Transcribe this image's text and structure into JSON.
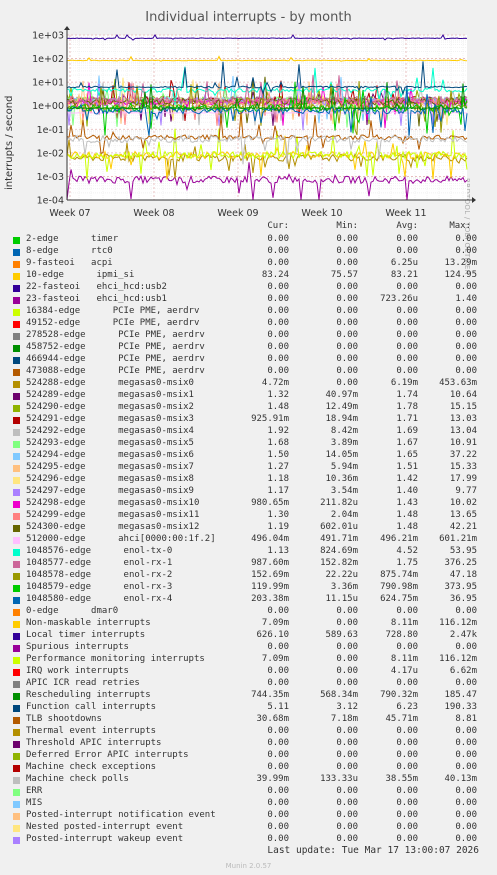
{
  "title": "Individual interrupts - by month",
  "side_label": "RRDTOOL / TOBI OETIKER",
  "footer": {
    "last_update": "Last update: Tue Mar 17 13:00:07 2026",
    "munin": "Munin 2.0.57"
  },
  "legend_headers": {
    "cur": "Cur:",
    "min": "Min:",
    "avg": "Avg:",
    "max": "Max:"
  },
  "chart_data": {
    "type": "line",
    "title": "Individual interrupts - by month",
    "ylabel": "interrupts / second",
    "xlabel": "",
    "y_scale": "log",
    "ylim": [
      0.0001,
      1000
    ],
    "y_ticks": [
      "1e-04",
      "1e-03",
      "1e-02",
      "1e-01",
      "1e+00",
      "1e+01",
      "1e+02",
      "1e+03"
    ],
    "x_ticks": [
      "Week 07",
      "Week 08",
      "Week 09",
      "Week 10",
      "Week 11"
    ],
    "grid": true,
    "series": [
      {
        "name": "2-edge      timer",
        "color": "#00cc00",
        "cur": "0.00",
        "min": "0.00",
        "avg": "0.00",
        "max": "0.00"
      },
      {
        "name": "8-edge      rtc0",
        "color": "#0066b3",
        "cur": "0.00",
        "min": "0.00",
        "avg": "0.00",
        "max": "0.00"
      },
      {
        "name": "9-fasteoi   acpi",
        "color": "#ff8000",
        "cur": "0.00",
        "min": "0.00",
        "avg": "6.25u",
        "max": "13.29m"
      },
      {
        "name": "10-edge      ipmi_si",
        "color": "#ffcc00",
        "cur": "83.24",
        "min": "75.57",
        "avg": "83.21",
        "max": "124.95"
      },
      {
        "name": "22-fasteoi   ehci_hcd:usb2",
        "color": "#330099",
        "cur": "0.00",
        "min": "0.00",
        "avg": "0.00",
        "max": "0.00"
      },
      {
        "name": "23-fasteoi   ehci_hcd:usb1",
        "color": "#990099",
        "cur": "0.00",
        "min": "0.00",
        "avg": "723.26u",
        "max": "1.40"
      },
      {
        "name": "16384-edge      PCIe PME, aerdrv",
        "color": "#ccff00",
        "cur": "0.00",
        "min": "0.00",
        "avg": "0.00",
        "max": "0.00"
      },
      {
        "name": "49152-edge      PCIe PME, aerdrv",
        "color": "#ff0000",
        "cur": "0.00",
        "min": "0.00",
        "avg": "0.00",
        "max": "0.00"
      },
      {
        "name": "278528-edge      PCIe PME, aerdrv",
        "color": "#808080",
        "cur": "0.00",
        "min": "0.00",
        "avg": "0.00",
        "max": "0.00"
      },
      {
        "name": "458752-edge      PCIe PME, aerdrv",
        "color": "#008f00",
        "cur": "0.00",
        "min": "0.00",
        "avg": "0.00",
        "max": "0.00"
      },
      {
        "name": "466944-edge      PCIe PME, aerdrv",
        "color": "#00487d",
        "cur": "0.00",
        "min": "0.00",
        "avg": "0.00",
        "max": "0.00"
      },
      {
        "name": "473088-edge      PCIe PME, aerdrv",
        "color": "#b35a00",
        "cur": "0.00",
        "min": "0.00",
        "avg": "0.00",
        "max": "0.00"
      },
      {
        "name": "524288-edge      megasas0-msix0",
        "color": "#b38f00",
        "cur": "4.72m",
        "min": "0.00",
        "avg": "6.19m",
        "max": "453.63m"
      },
      {
        "name": "524289-edge      megasas0-msix1",
        "color": "#6b006b",
        "cur": "1.32",
        "min": "40.97m",
        "avg": "1.74",
        "max": "10.64"
      },
      {
        "name": "524290-edge      megasas0-msix2",
        "color": "#8fb300",
        "cur": "1.48",
        "min": "12.49m",
        "avg": "1.78",
        "max": "15.15"
      },
      {
        "name": "524291-edge      megasas0-msix3",
        "color": "#b30000",
        "cur": "925.91m",
        "min": "18.94m",
        "avg": "1.71",
        "max": "13.03"
      },
      {
        "name": "524292-edge      megasas0-msix4",
        "color": "#bebebe",
        "cur": "1.92",
        "min": "8.42m",
        "avg": "1.69",
        "max": "13.04"
      },
      {
        "name": "524293-edge      megasas0-msix5",
        "color": "#80ff80",
        "cur": "1.68",
        "min": "3.89m",
        "avg": "1.67",
        "max": "10.91"
      },
      {
        "name": "524294-edge      megasas0-msix6",
        "color": "#80c9ff",
        "cur": "1.50",
        "min": "14.05m",
        "avg": "1.65",
        "max": "37.22"
      },
      {
        "name": "524295-edge      megasas0-msix7",
        "color": "#ffc080",
        "cur": "1.27",
        "min": "5.94m",
        "avg": "1.51",
        "max": "15.33"
      },
      {
        "name": "524296-edge      megasas0-msix8",
        "color": "#ffe680",
        "cur": "1.18",
        "min": "10.36m",
        "avg": "1.42",
        "max": "17.99"
      },
      {
        "name": "524297-edge      megasas0-msix9",
        "color": "#aa80ff",
        "cur": "1.17",
        "min": "3.54m",
        "avg": "1.40",
        "max": "9.77"
      },
      {
        "name": "524298-edge      megasas0-msix10",
        "color": "#ee00cc",
        "cur": "980.65m",
        "min": "211.82u",
        "avg": "1.43",
        "max": "10.02"
      },
      {
        "name": "524299-edge      megasas0-msix11",
        "color": "#ff8080",
        "cur": "1.30",
        "min": "2.04m",
        "avg": "1.48",
        "max": "13.65"
      },
      {
        "name": "524300-edge      megasas0-msix12",
        "color": "#666600",
        "cur": "1.19",
        "min": "602.01u",
        "avg": "1.48",
        "max": "42.21"
      },
      {
        "name": "512000-edge      ahci[0000:00:1f.2]",
        "color": "#ffbfff",
        "cur": "496.04m",
        "min": "491.71m",
        "avg": "496.21m",
        "max": "601.21m"
      },
      {
        "name": "1048576-edge      enol-tx-0",
        "color": "#00ffcc",
        "cur": "1.13",
        "min": "824.69m",
        "avg": "4.52",
        "max": "53.95"
      },
      {
        "name": "1048577-edge      enol-rx-1",
        "color": "#cc6699",
        "cur": "987.60m",
        "min": "152.82m",
        "avg": "1.75",
        "max": "376.25"
      },
      {
        "name": "1048578-edge      enol-rx-2",
        "color": "#999900",
        "cur": "152.69m",
        "min": "22.22u",
        "avg": "875.74m",
        "max": "47.18"
      },
      {
        "name": "1048579-edge      enol-rx-3",
        "color": "#00cc00",
        "cur": "119.99m",
        "min": "3.36m",
        "avg": "790.98m",
        "max": "373.95"
      },
      {
        "name": "1048580-edge      enol-rx-4",
        "color": "#0066b3",
        "cur": "203.38m",
        "min": "11.15u",
        "avg": "624.75m",
        "max": "36.95"
      },
      {
        "name": "0-edge      dmar0",
        "color": "#ff8000",
        "cur": "0.00",
        "min": "0.00",
        "avg": "0.00",
        "max": "0.00"
      },
      {
        "name": "Non-maskable interrupts",
        "color": "#ffcc00",
        "cur": "7.09m",
        "min": "0.00",
        "avg": "8.11m",
        "max": "116.12m"
      },
      {
        "name": "Local timer interrupts",
        "color": "#330099",
        "cur": "626.10",
        "min": "589.63",
        "avg": "728.80",
        "max": "2.47k"
      },
      {
        "name": "Spurious interrupts",
        "color": "#990099",
        "cur": "0.00",
        "min": "0.00",
        "avg": "0.00",
        "max": "0.00"
      },
      {
        "name": "Performance monitoring interrupts",
        "color": "#ccff00",
        "cur": "7.09m",
        "min": "0.00",
        "avg": "8.11m",
        "max": "116.12m"
      },
      {
        "name": "IRQ work interrupts",
        "color": "#ff0000",
        "cur": "0.00",
        "min": "0.00",
        "avg": "4.17u",
        "max": "6.62m"
      },
      {
        "name": "APIC ICR read retries",
        "color": "#808080",
        "cur": "0.00",
        "min": "0.00",
        "avg": "0.00",
        "max": "0.00"
      },
      {
        "name": "Rescheduling interrupts",
        "color": "#008f00",
        "cur": "744.35m",
        "min": "568.34m",
        "avg": "790.32m",
        "max": "185.47"
      },
      {
        "name": "Function call interrupts",
        "color": "#00487d",
        "cur": "5.11",
        "min": "3.12",
        "avg": "6.23",
        "max": "190.33"
      },
      {
        "name": "TLB shootdowns",
        "color": "#b35a00",
        "cur": "30.68m",
        "min": "7.18m",
        "avg": "45.71m",
        "max": "8.81"
      },
      {
        "name": "Thermal event interrupts",
        "color": "#b38f00",
        "cur": "0.00",
        "min": "0.00",
        "avg": "0.00",
        "max": "0.00"
      },
      {
        "name": "Threshold APIC interrupts",
        "color": "#6b006b",
        "cur": "0.00",
        "min": "0.00",
        "avg": "0.00",
        "max": "0.00"
      },
      {
        "name": "Deferred Error APIC interrupts",
        "color": "#8fb300",
        "cur": "0.00",
        "min": "0.00",
        "avg": "0.00",
        "max": "0.00"
      },
      {
        "name": "Machine check exceptions",
        "color": "#b30000",
        "cur": "0.00",
        "min": "0.00",
        "avg": "0.00",
        "max": "0.00"
      },
      {
        "name": "Machine check polls",
        "color": "#bebebe",
        "cur": "39.99m",
        "min": "133.33u",
        "avg": "38.55m",
        "max": "40.13m"
      },
      {
        "name": "ERR",
        "color": "#80ff80",
        "cur": "0.00",
        "min": "0.00",
        "avg": "0.00",
        "max": "0.00"
      },
      {
        "name": "MIS",
        "color": "#80c9ff",
        "cur": "0.00",
        "min": "0.00",
        "avg": "0.00",
        "max": "0.00"
      },
      {
        "name": "Posted-interrupt notification event",
        "color": "#ffc080",
        "cur": "0.00",
        "min": "0.00",
        "avg": "0.00",
        "max": "0.00"
      },
      {
        "name": "Nested posted-interrupt event",
        "color": "#ffe680",
        "cur": "0.00",
        "min": "0.00",
        "avg": "0.00",
        "max": "0.00"
      },
      {
        "name": "Posted-interrupt wakeup event",
        "color": "#aa80ff",
        "cur": "0.00",
        "min": "0.00",
        "avg": "0.00",
        "max": "0.00"
      }
    ]
  }
}
